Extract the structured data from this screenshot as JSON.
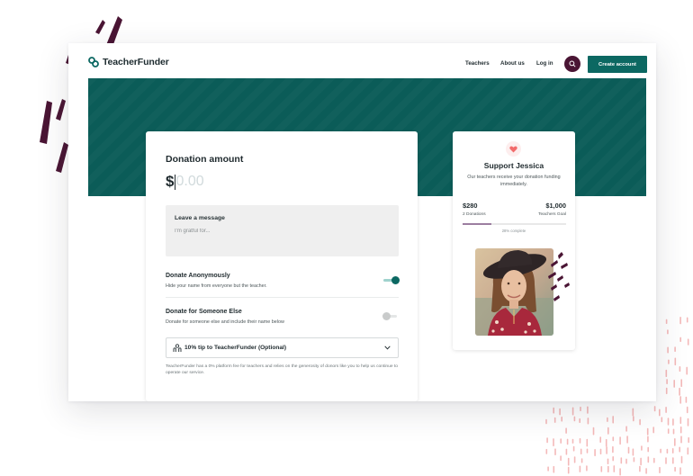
{
  "nav": {
    "brand": "TeacherFunder",
    "links": [
      "Teachers",
      "About us",
      "Log in"
    ],
    "create_account": "Create account"
  },
  "donation": {
    "title": "Donation amount",
    "currency_symbol": "$",
    "amount_placeholder": "0.00",
    "message_label": "Leave a message",
    "message_placeholder": "I'm gratful for...",
    "options": [
      {
        "title": "Donate Anonymously",
        "subtitle": "Hide your name from everyone but the teacher.",
        "enabled": true
      },
      {
        "title": "Donate for Someone Else",
        "subtitle": "Donate for someone else and include their name below",
        "enabled": false
      }
    ],
    "tip_label": "10% tip to TeacherFunder (Optional)",
    "fee_note": "TeacherFunder has a 0% platform fee for teachers and relies on the generosity of donors like you to help us continue to operate our service."
  },
  "support": {
    "title": "Support Jessica",
    "description": "Our teachers receive your donation funding immediately.",
    "raised": "$280",
    "raised_label": "2 Donations",
    "goal": "$1,000",
    "goal_label": "Teachers Goal",
    "progress_text": "28% complete",
    "progress_fraction": 0.28
  },
  "colors": {
    "brand_teal": "#0c6862",
    "hero_band": "#0b5c58",
    "accent_plum": "#4a1534",
    "heart": "#f26b6b",
    "deco_pink": "#f4b9b9"
  },
  "icons": [
    "logo-icon",
    "search-icon",
    "heart-icon",
    "hand-coin-icon",
    "chevron-down-icon"
  ]
}
